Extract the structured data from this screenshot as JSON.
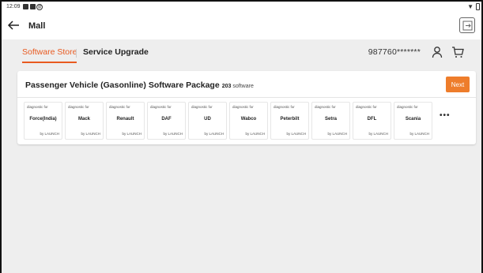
{
  "status_bar": {
    "time": "12:09"
  },
  "header": {
    "title": "Mall"
  },
  "tabs": [
    {
      "label": "Software Store"
    },
    {
      "label": "Service Upgrade"
    }
  ],
  "account": {
    "id": "987760*******"
  },
  "package": {
    "title": "Passenger Vehicle (Gasonline) Software Package",
    "count": "203",
    "count_unit": "software",
    "next_label": "Next"
  },
  "cards": [
    {
      "diag": "diagnostic for",
      "name": "Force(India)",
      "by": "by LAUNCH"
    },
    {
      "diag": "diagnostic for",
      "name": "Mack",
      "by": "by LAUNCH"
    },
    {
      "diag": "diagnostic for",
      "name": "Renault",
      "by": "by LAUNCH"
    },
    {
      "diag": "diagnostic for",
      "name": "DAF",
      "by": "by LAUNCH"
    },
    {
      "diag": "diagnostic for",
      "name": "UD",
      "by": "by LAUNCH"
    },
    {
      "diag": "diagnostic for",
      "name": "Wabco",
      "by": "by LAUNCH"
    },
    {
      "diag": "diagnostic for",
      "name": "Peterbilt",
      "by": "by LAUNCH"
    },
    {
      "diag": "diagnostic for",
      "name": "Setra",
      "by": "by LAUNCH"
    },
    {
      "diag": "diagnostic for",
      "name": "DFL",
      "by": "by LAUNCH"
    },
    {
      "diag": "diagnostic for",
      "name": "Scania",
      "by": "by LAUNCH"
    }
  ],
  "more_label": "•••",
  "colors": {
    "accent": "#e85a20",
    "button": "#ee7d2b",
    "background": "#eeeeee"
  },
  "icons": [
    "back-arrow-icon",
    "exit-icon",
    "user-icon",
    "cart-icon",
    "wifi-icon",
    "battery-icon"
  ]
}
